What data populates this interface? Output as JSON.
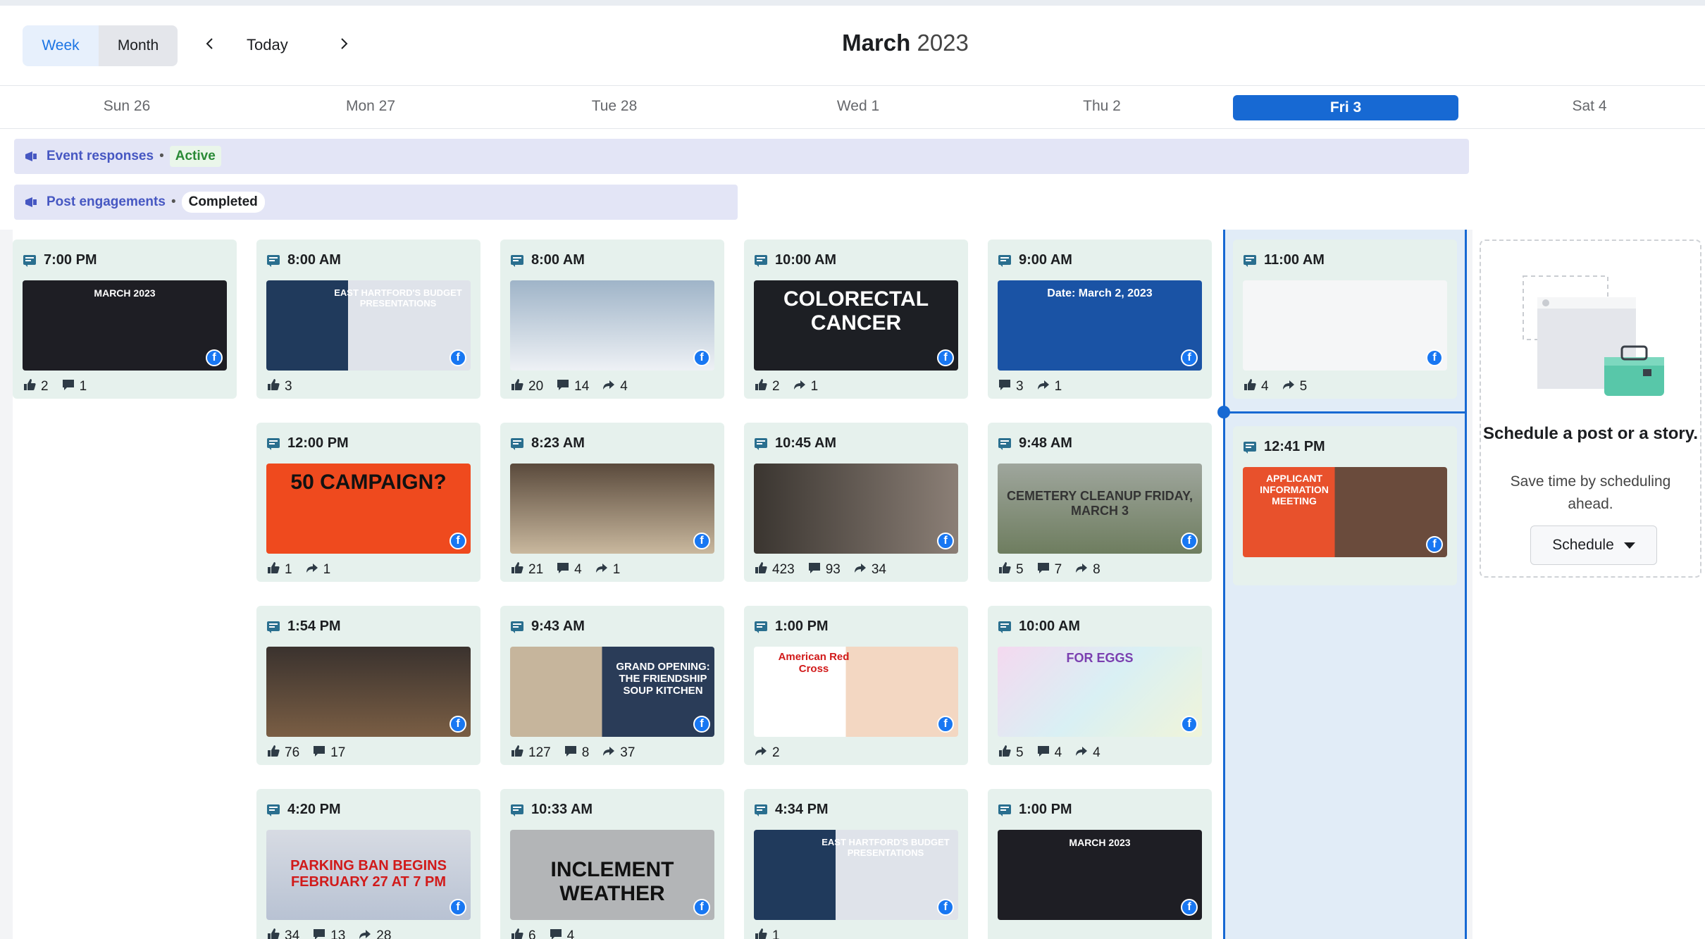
{
  "toolbar": {
    "view_week": "Week",
    "view_month": "Month",
    "today": "Today",
    "month": "March",
    "year": "2023",
    "prev_icon": "chevron-left-icon",
    "next_icon": "chevron-right-icon"
  },
  "days": [
    {
      "label": "Sun 26"
    },
    {
      "label": "Mon 27"
    },
    {
      "label": "Tue 28"
    },
    {
      "label": "Wed 1"
    },
    {
      "label": "Thu 2"
    },
    {
      "label": "Fri 3",
      "today": true
    },
    {
      "label": "Sat 4"
    }
  ],
  "campaigns": [
    {
      "name": "Event responses",
      "status": "Active"
    },
    {
      "name": "Post engagements",
      "status": "Completed"
    }
  ],
  "posts": {
    "sun": [
      {
        "time": "7:00 PM",
        "thumb": "MARCH 2023",
        "likes": "2",
        "comments": "1"
      }
    ],
    "mon": [
      {
        "time": "8:00 AM",
        "thumb": "EAST HARTFORD'S BUDGET PRESENTATIONS",
        "likes": "3"
      },
      {
        "time": "12:00 PM",
        "thumb": "50 CAMPAIGN?",
        "likes": "1",
        "shares": "1"
      },
      {
        "time": "1:54 PM",
        "likes": "76",
        "comments": "17"
      },
      {
        "time": "4:20 PM",
        "thumb": "PARKING BAN BEGINS FEBRUARY 27 AT 7 PM",
        "likes": "34",
        "comments": "13",
        "shares": "28"
      }
    ],
    "tue": [
      {
        "time": "8:00 AM",
        "likes": "20",
        "comments": "14",
        "shares": "4"
      },
      {
        "time": "8:23 AM",
        "likes": "21",
        "comments": "4",
        "shares": "1"
      },
      {
        "time": "9:43 AM",
        "thumb": "GRAND OPENING: THE FRIENDSHIP SOUP KITCHEN",
        "likes": "127",
        "comments": "8",
        "shares": "37"
      },
      {
        "time": "10:33 AM",
        "thumb": "INCLEMENT WEATHER",
        "likes": "6",
        "comments": "4"
      }
    ],
    "wed": [
      {
        "time": "10:00 AM",
        "thumb": "COLORECTAL CANCER",
        "likes": "2",
        "shares": "1"
      },
      {
        "time": "10:45 AM",
        "likes": "423",
        "comments": "93",
        "shares": "34"
      },
      {
        "time": "1:00 PM",
        "thumb": "American Red Cross",
        "shares": "2"
      },
      {
        "time": "4:34 PM",
        "thumb": "EAST HARTFORD'S BUDGET PRESENTATIONS",
        "likes": "1"
      }
    ],
    "thu": [
      {
        "time": "9:00 AM",
        "thumb": "Date: March 2, 2023",
        "comments": "3",
        "shares": "1"
      },
      {
        "time": "9:48 AM",
        "thumb": "CEMETERY CLEANUP FRIDAY, MARCH 3",
        "likes": "5",
        "comments": "7",
        "shares": "8"
      },
      {
        "time": "10:00 AM",
        "thumb": "FOR EGGS",
        "likes": "5",
        "comments": "4",
        "shares": "4"
      },
      {
        "time": "1:00 PM",
        "thumb": "MARCH 2023"
      }
    ],
    "fri": [
      {
        "time": "11:00 AM",
        "likes": "4",
        "shares": "5"
      },
      {
        "time": "12:41 PM",
        "thumb": "APPLICANT INFORMATION MEETING"
      }
    ]
  },
  "schedule": {
    "title": "Schedule a post or a story.",
    "subtitle": "Save time by scheduling ahead.",
    "button": "Schedule"
  }
}
